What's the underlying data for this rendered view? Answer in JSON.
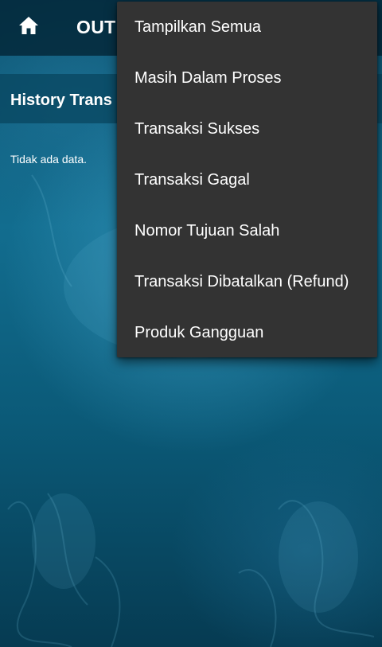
{
  "app_bar": {
    "home_icon": "home-icon",
    "title": "OUT"
  },
  "section": {
    "title": "History Trans"
  },
  "empty_state": {
    "text": "Tidak ada data."
  },
  "menu": {
    "items": [
      {
        "label": "Tampilkan Semua"
      },
      {
        "label": "Masih Dalam Proses"
      },
      {
        "label": "Transaksi Sukses"
      },
      {
        "label": "Transaksi Gagal"
      },
      {
        "label": "Nomor Tujuan Salah"
      },
      {
        "label": "Transaksi Dibatalkan (Refund)"
      },
      {
        "label": "Produk Gangguan"
      }
    ]
  },
  "colors": {
    "menu_background": "#333333",
    "app_bar": "#04283a",
    "text": "#ffffff"
  }
}
